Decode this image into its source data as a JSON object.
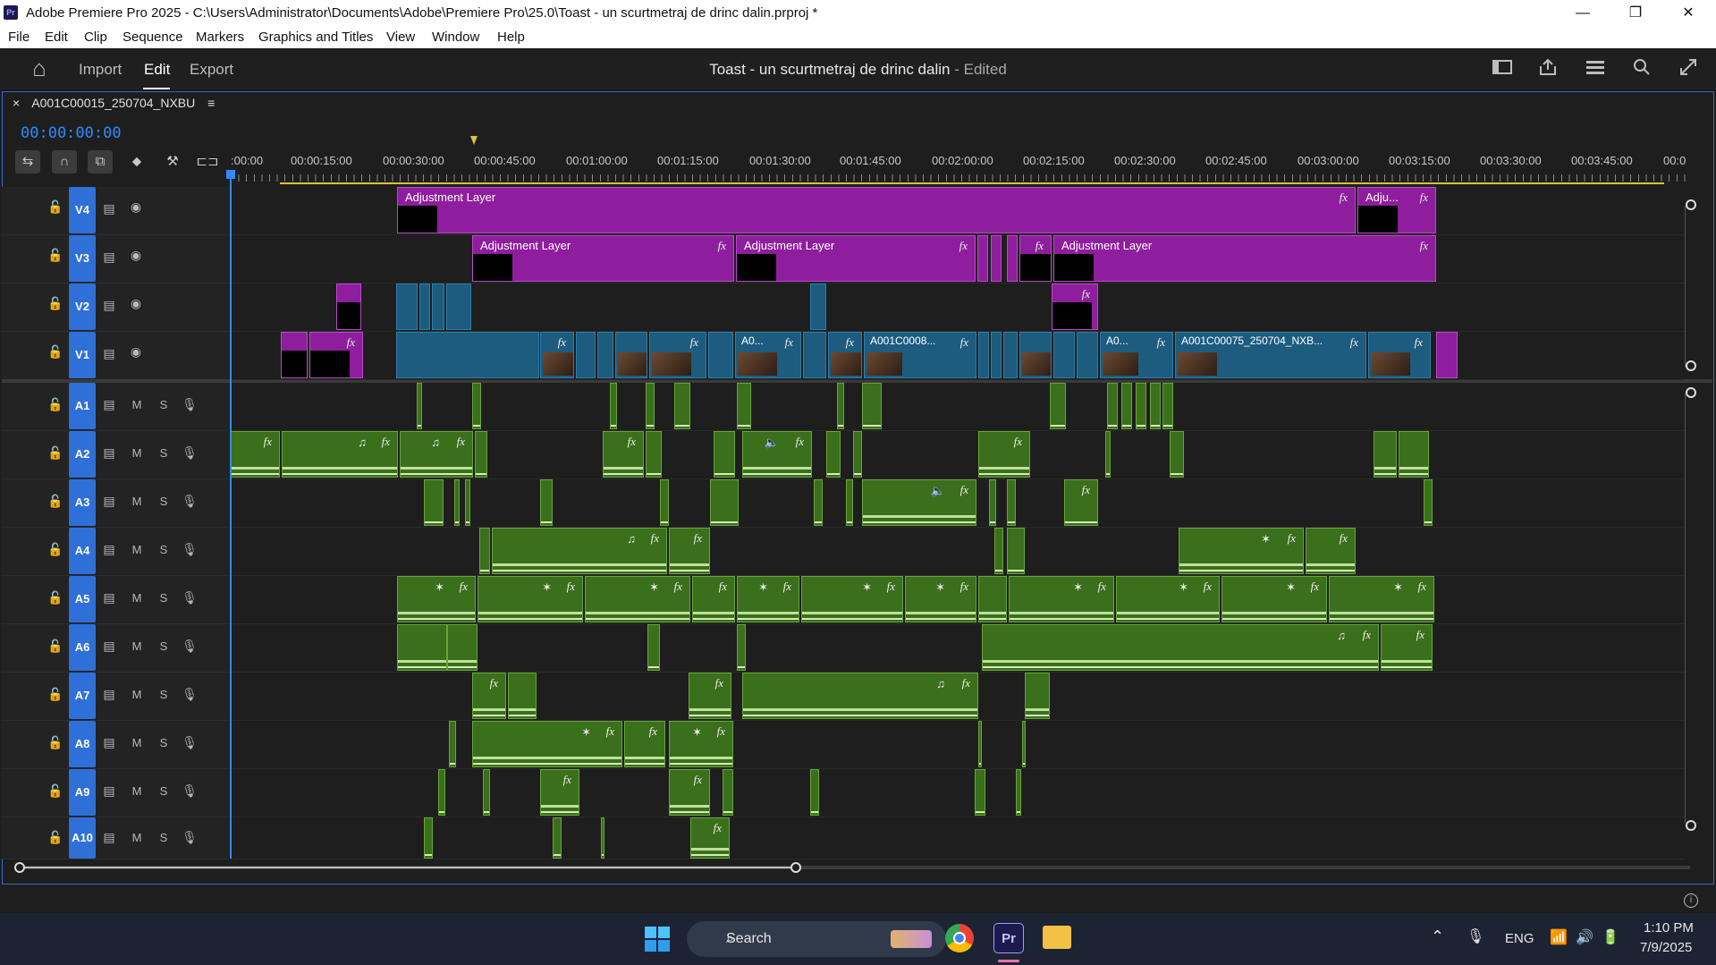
{
  "window": {
    "title": "Adobe Premiere Pro 2025 - C:\\Users\\Administrator\\Documents\\Adobe\\Premiere Pro\\25.0\\Toast - un scurtmetraj de drinc dalin.prproj *",
    "app_icon": "Pr",
    "minimize": "—",
    "maximize": "❐",
    "close": "✕"
  },
  "menu": [
    "File",
    "Edit",
    "Clip",
    "Sequence",
    "Markers",
    "Graphics and Titles",
    "View",
    "Window",
    "Help"
  ],
  "header": {
    "home_icon": "⌂",
    "nav": [
      "Import",
      "Edit",
      "Export"
    ],
    "active_nav": "Edit",
    "doc_title": "Toast - un scurtmetraj de drinc dalin",
    "doc_status": "- Edited"
  },
  "timeline": {
    "sequence_tab": "A001C00015_250704_NXBU",
    "close_tab": "×",
    "tab_menu": "≡",
    "timecode": "00:00:00:00",
    "ruler_labels": [
      ":00:00",
      "00:00:15:00",
      "00:00:30:00",
      "00:00:45:00",
      "00:01:00:00",
      "00:01:15:00",
      "00:01:30:00",
      "00:01:45:00",
      "00:02:00:00",
      "00:02:15:00",
      "00:02:30:00",
      "00:02:45:00",
      "00:03:00:00",
      "00:03:15:00",
      "00:03:30:00",
      "00:03:45:00",
      "00:0"
    ],
    "video_tracks": [
      "V4",
      "V3",
      "V2",
      "V1"
    ],
    "audio_tracks": [
      "A1",
      "A2",
      "A3",
      "A4",
      "A5",
      "A6",
      "A7",
      "A8",
      "A9",
      "A10"
    ],
    "track_toggles": {
      "mute": "M",
      "solo": "S"
    },
    "clip_labels": {
      "adjustment": "Adjustment Layer",
      "adjustment_short": "Adju...",
      "v1_a": "A0...",
      "v1_b": "A001C0008...",
      "v1_c": "A0...",
      "v1_d": "A001C00075_250704_NXB..."
    },
    "fx_badge": "fx"
  },
  "taskbar": {
    "search_placeholder": "Search",
    "language": "ENG",
    "time": "1:10 PM",
    "date": "7/9/2025"
  },
  "colors": {
    "accent": "#2f8bff",
    "adjustment": "#8f1e9e",
    "video": "#1d5c7f",
    "audio": "#3a6f1b",
    "track_target": "#2f6fd8"
  }
}
